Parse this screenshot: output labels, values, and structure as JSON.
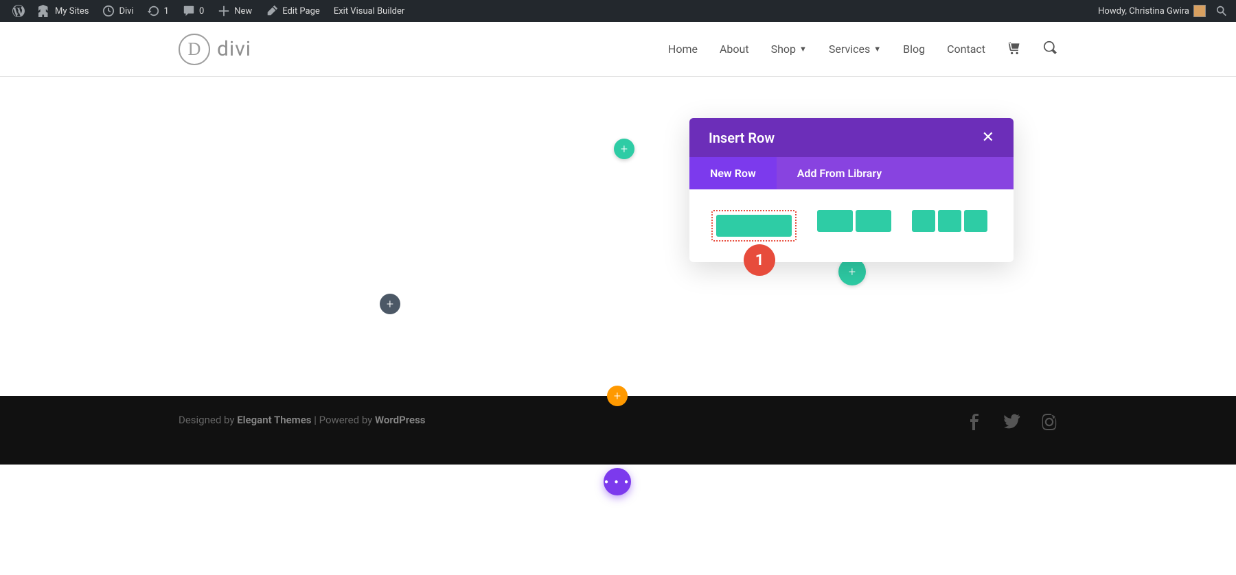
{
  "admin_bar": {
    "my_sites": "My Sites",
    "site_name": "Divi",
    "updates_count": "1",
    "comments_count": "0",
    "new_label": "New",
    "edit_page": "Edit Page",
    "exit_vb": "Exit Visual Builder",
    "howdy": "Howdy, Christina Gwira"
  },
  "header": {
    "logo_letter": "D",
    "logo_text": "divi",
    "nav": {
      "home": "Home",
      "about": "About",
      "shop": "Shop",
      "services": "Services",
      "blog": "Blog",
      "contact": "Contact"
    }
  },
  "modal": {
    "title": "Insert Row",
    "tab_new": "New Row",
    "tab_library": "Add From Library",
    "badge": "1"
  },
  "footer": {
    "designed_by": "Designed by ",
    "elegant": "Elegant Themes",
    "sep": " | Powered by ",
    "wordpress": "WordPress"
  },
  "colors": {
    "purple": "#7c3aed",
    "purple_dark": "#6c2eb9",
    "teal": "#2ecca5",
    "orange": "#ff9900",
    "red": "#e74c3c"
  }
}
